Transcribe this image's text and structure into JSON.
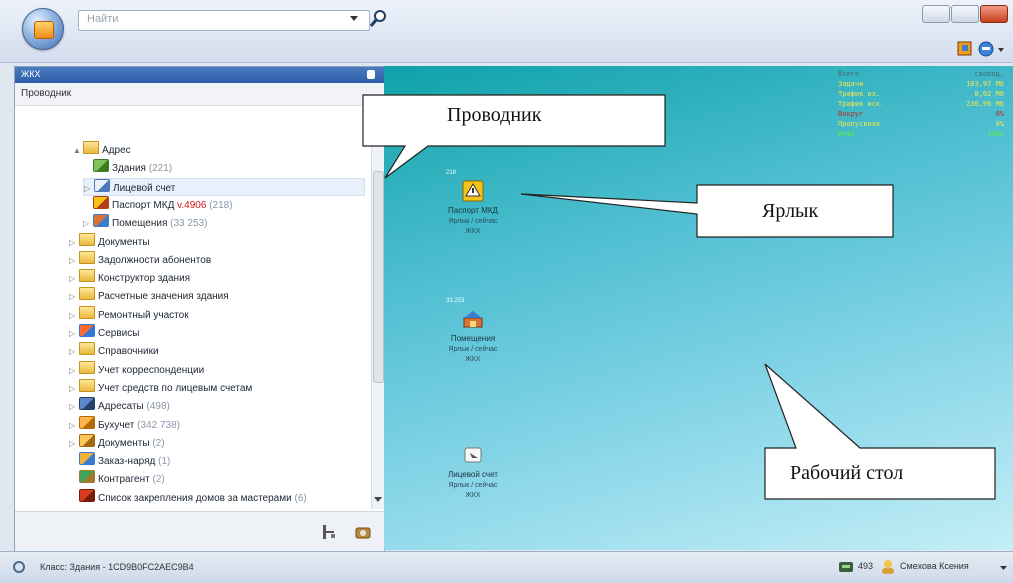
{
  "search": {
    "placeholder": "Найти"
  },
  "panel": {
    "header_title": "ЖКХ",
    "section_label": "Проводник"
  },
  "tree": [
    {
      "label": "Адрес",
      "count": "",
      "icon": "folder-icon",
      "level": 0,
      "arrow": "▲"
    },
    {
      "label": "Здания",
      "count": "(221)",
      "icon": "building-icon",
      "level": 1,
      "arrow": ""
    },
    {
      "label": "Лицевой счет",
      "count": "",
      "icon": "account-icon",
      "level": 1,
      "arrow": "▷",
      "selected": true
    },
    {
      "label": "Паспорт МКД",
      "version": "v.4906",
      "count": "(218)",
      "icon": "passport-icon",
      "level": 1,
      "arrow": ""
    },
    {
      "label": "Помещения",
      "count": "(33 253)",
      "icon": "rooms-icon",
      "level": 1,
      "arrow": "▷"
    },
    {
      "label": "Документы",
      "count": "",
      "icon": "folder-icon",
      "level": 0,
      "arrow": "▷"
    },
    {
      "label": "Задолжности абонентов",
      "count": "",
      "icon": "folder-icon",
      "level": 0,
      "arrow": "▷"
    },
    {
      "label": "Конструктор здания",
      "count": "",
      "icon": "folder-icon",
      "level": 0,
      "arrow": "▷"
    },
    {
      "label": "Расчетные значения здания",
      "count": "",
      "icon": "folder-icon",
      "level": 0,
      "arrow": "▷"
    },
    {
      "label": "Ремонтный участок",
      "count": "",
      "icon": "folder-icon",
      "level": 0,
      "arrow": "▷"
    },
    {
      "label": "Сервисы",
      "count": "",
      "icon": "services-icon",
      "level": 0,
      "arrow": "▷"
    },
    {
      "label": "Справочники",
      "count": "",
      "icon": "folder-icon",
      "level": 0,
      "arrow": "▷"
    },
    {
      "label": "Учет корреспонденции",
      "count": "",
      "icon": "folder-icon",
      "level": 0,
      "arrow": "▷"
    },
    {
      "label": "Учет средств по лицевым счетам",
      "count": "",
      "icon": "folder-icon",
      "level": 0,
      "arrow": "▷"
    },
    {
      "label": "Адресаты",
      "count": "(498)",
      "icon": "addressees-icon",
      "level": 0,
      "arrow": "▷"
    },
    {
      "label": "Бухучет",
      "count": "(342 738)",
      "icon": "accounting-icon",
      "level": 0,
      "arrow": "▷"
    },
    {
      "label": "Документы",
      "count": "(2)",
      "icon": "documents-icon",
      "level": 0,
      "arrow": "▷"
    },
    {
      "label": "Заказ-наряд",
      "count": "(1)",
      "icon": "order-icon",
      "level": 0,
      "arrow": ""
    },
    {
      "label": "Контрагент",
      "count": "(2)",
      "icon": "contractor-icon",
      "level": 0,
      "arrow": ""
    },
    {
      "label": "Список закрепления домов за мастерами",
      "count": "(6)",
      "icon": "list-icon",
      "level": 0,
      "arrow": ""
    }
  ],
  "stats": [
    {
      "key": "Всего",
      "value": "свобод.",
      "color": "#4a6a78"
    },
    {
      "key": "Задачи",
      "value": "103,97 Мб",
      "color": "#f3e64a"
    },
    {
      "key": "Трафик вх.",
      "value": "0,02 Мб",
      "color": "#f3e64a"
    },
    {
      "key": "Трафик исх.",
      "value": "230,96 Мб",
      "color": "#f3e64a"
    },
    {
      "key": "Вокруг",
      "value": "0%",
      "color": "#c03020"
    },
    {
      "key": "Пропускная",
      "value": "0%",
      "color": "#f3e64a"
    },
    {
      "key": "Инфо",
      "value": "1004",
      "color": "#52f04a"
    }
  ],
  "shortcuts": [
    {
      "badge": "218",
      "label": "Паспорт МКД",
      "sub": "Ярлык / сейчас",
      "sub2": "ЖКХ",
      "icon": "passport-shortcut-icon"
    },
    {
      "badge": "33 253",
      "label": "Помещения",
      "sub": "Ярлык / сейчас",
      "sub2": "ЖКХ",
      "icon": "rooms-shortcut-icon"
    },
    {
      "badge": "",
      "label": "Лицевой счет",
      "sub": "Ярлык / сейчас",
      "sub2": "ЖКХ",
      "icon": "account-shortcut-icon"
    }
  ],
  "callouts": {
    "explorer": "Проводник",
    "shortcut": "Ярлык",
    "desktop": "Рабочий стол"
  },
  "status": {
    "class_text": "Класс: Здания - 1CD9B0FC2AEC9B4",
    "count": "493",
    "user": "Смехова Ксения"
  },
  "colors": {
    "desktop_top": "#0fa2a8",
    "desktop_bottom": "#c4eef6",
    "panel_header": "#2d5ea7"
  }
}
